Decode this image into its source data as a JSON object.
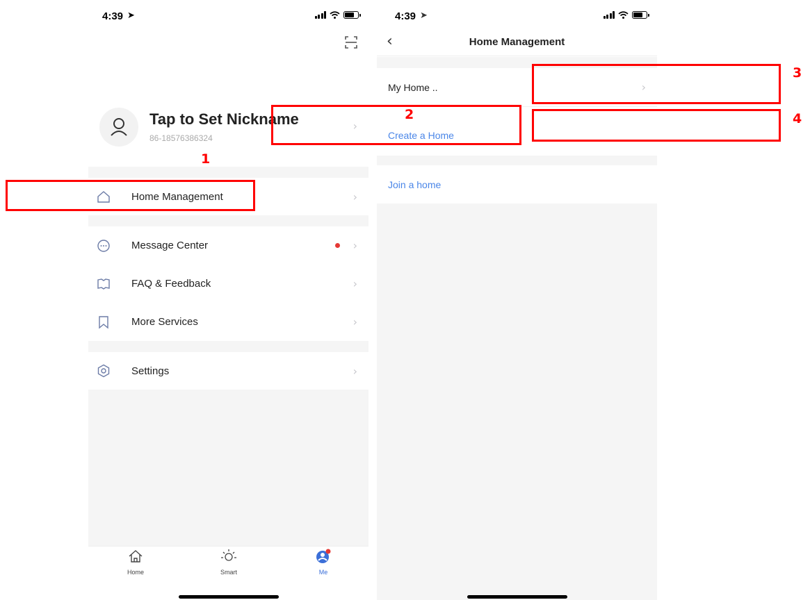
{
  "left_screen": {
    "status_time": "4:39",
    "profile": {
      "nickname": "Tap to Set Nickname",
      "phone": "86-18576386324"
    },
    "menu": {
      "home_management": "Home Management",
      "message_center": "Message Center",
      "faq_feedback": "FAQ & Feedback",
      "more_services": "More Services",
      "settings": "Settings"
    },
    "tabbar": {
      "home": "Home",
      "smart": "Smart",
      "me": "Me"
    }
  },
  "right_screen": {
    "status_time": "4:39",
    "nav_title": "Home Management",
    "my_home": "My Home ..",
    "create_home": "Create a Home",
    "join_home": "Join a home"
  },
  "annotations": {
    "n1": "1",
    "n2": "2",
    "n3": "3",
    "n4": "4"
  },
  "colors": {
    "highlight": "#ff0000",
    "link": "#4a86e8",
    "badge": "#e53935",
    "accent": "#3b6fd8"
  }
}
